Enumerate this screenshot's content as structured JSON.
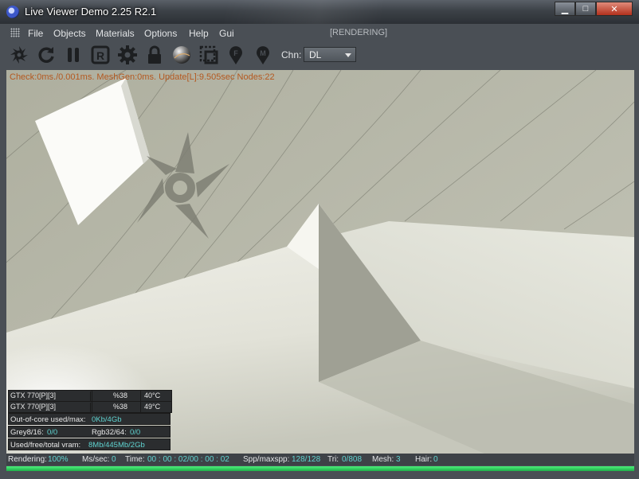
{
  "window": {
    "title": "Live Viewer Demo 2.25 R2.1",
    "controls": {
      "minimize": "▁",
      "maximize": "□",
      "close": "✕"
    }
  },
  "menu": {
    "items": [
      "File",
      "Objects",
      "Materials",
      "Options",
      "Help",
      "Gui"
    ],
    "status": "[RENDERING]"
  },
  "toolbar": {
    "tools": [
      "octane-logo-icon",
      "refresh-icon",
      "pause-icon",
      "render-r-icon",
      "settings-gear-icon",
      "lock-icon",
      "material-sphere-icon",
      "region-render-icon",
      "focus-picker-icon",
      "material-picker-icon"
    ],
    "channel_label": "Chn:",
    "channel_value": "DL"
  },
  "viewport": {
    "info_line": "Check:0ms./0.001ms. MeshGen:0ms. Update[L]:9.505sec Nodes:22",
    "gpus": [
      {
        "name": "GTX 770[P][3]",
        "usage": "%38",
        "temp": "40°C"
      },
      {
        "name": "GTX 770[P][3]",
        "usage": "%38",
        "temp": "49°C"
      }
    ],
    "out_of_core_label": "Out-of-core used/max:",
    "out_of_core_value": "0Kb/4Gb",
    "grey_label": "Grey8/16:",
    "grey_value": "0/0",
    "rgb_label": "Rgb32/64:",
    "rgb_value": "0/0",
    "vram_label": "Used/free/total vram:",
    "vram_value": "8Mb/445Mb/2Gb"
  },
  "status": {
    "rendering_label": "Rendering:",
    "rendering_value": "100%",
    "ms_label": "Ms/sec:",
    "ms_value": "0",
    "time_label": "Time:",
    "time_value": "00 : 00 : 02/00 : 00 : 02",
    "spp_label": "Spp/maxspp:",
    "spp_value": "128/128",
    "tri_label": "Tri:",
    "tri_value": "0/808",
    "mesh_label": "Mesh:",
    "mesh_value": "3",
    "hair_label": "Hair:",
    "hair_value": "0",
    "progress_fraction": 1.0
  },
  "colors": {
    "info_text": "#b4581f",
    "stat_value": "#5fd3d0",
    "progress": "#2fcf5a"
  }
}
